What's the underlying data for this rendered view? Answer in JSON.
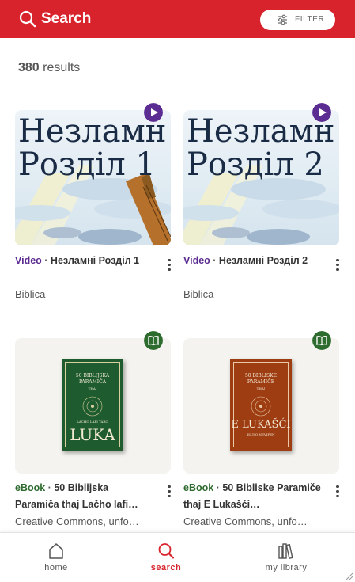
{
  "header": {
    "title": "Search",
    "filter_label": "FILTER",
    "accent": "#d8232c"
  },
  "results": {
    "count": "380",
    "label": "results"
  },
  "items": [
    {
      "type": "Video",
      "title": "Незламні Розділ 1",
      "publisher": "Biblica",
      "thumb_line1": "Незламн",
      "thumb_line2": "Розділ 1",
      "badge": "play-icon",
      "type_color": "#5b2c91"
    },
    {
      "type": "Video",
      "title": "Незламні Розділ 2",
      "publisher": "Biblica",
      "thumb_line1": "Незламн",
      "thumb_line2": "Розділ 2",
      "badge": "play-icon",
      "type_color": "#5b2c91"
    },
    {
      "type": "eBook",
      "title": "50 Biblijska Paramiča thaj Lačho lafi…",
      "publisher": "Creative Commons, unfo…",
      "cover_line1": "50 BIBLIJSKA",
      "cover_line2": "PARAMIČA",
      "cover_line3": "THAJ",
      "cover_line4": "LAČHO LAFI TARO",
      "cover_main": "LUKA",
      "cover_color": "#1e5b2e",
      "badge": "book-icon",
      "type_color": "#2e6b2e"
    },
    {
      "type": "eBook",
      "title": "50 Bibliske Paramiče thaj E Lukašći…",
      "publisher": "Creative Commons, unfo…",
      "cover_line1": "50 BIBLISKE",
      "cover_line2": "PARAMIČE",
      "cover_line3": "THAJ",
      "cover_main": "E LUKAŠĆI",
      "cover_sub": "ISUSO NEVIPEN",
      "cover_color": "#9e3d12",
      "badge": "book-icon",
      "type_color": "#2e6b2e"
    }
  ],
  "separator": " · ",
  "nav": [
    {
      "label": "home",
      "icon": "home-icon"
    },
    {
      "label": "search",
      "icon": "search-icon",
      "active": true
    },
    {
      "label": "my library",
      "icon": "library-icon"
    }
  ]
}
